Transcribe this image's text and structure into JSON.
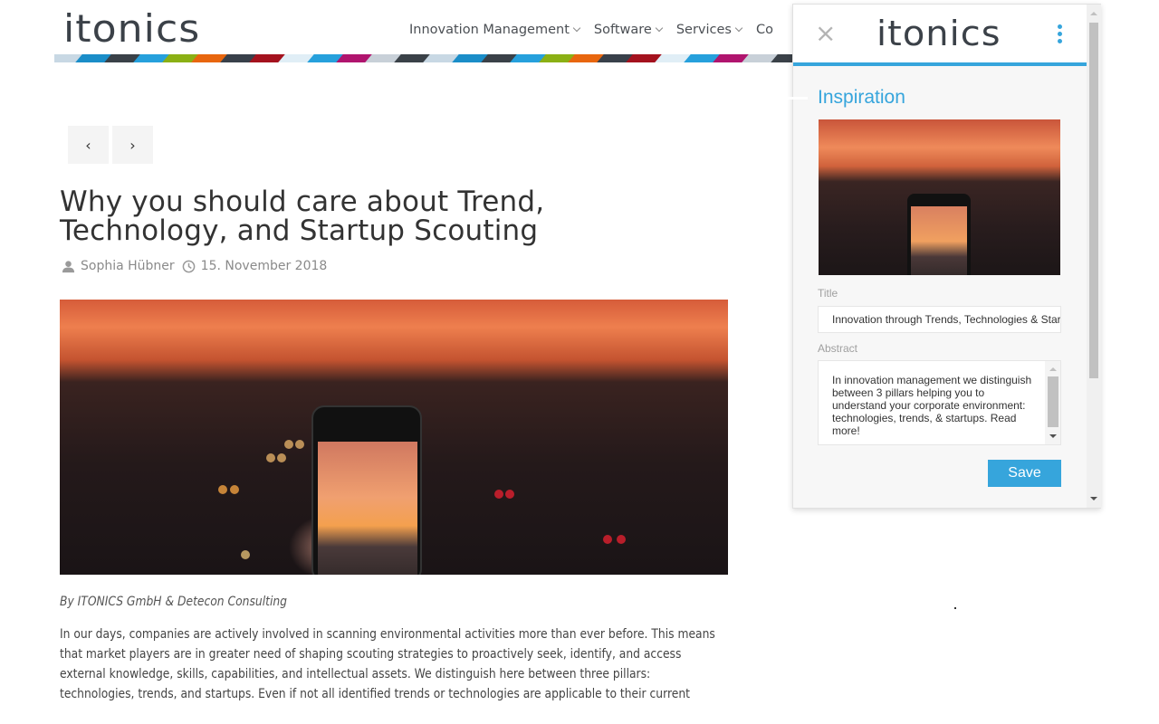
{
  "site": {
    "logo": "itonics",
    "nav": [
      {
        "label": "Innovation Management"
      },
      {
        "label": "Software"
      },
      {
        "label": "Services"
      },
      {
        "label": "Co"
      }
    ],
    "ribbon_colors": [
      "#c8d8e4",
      "#1a8dc8",
      "#3a4148",
      "#26a0dc",
      "#8bb014",
      "#e8660e",
      "#38404a",
      "#a4121e",
      "#e0eef6",
      "#26a0dc",
      "#b0146e",
      "#c8d0d8",
      "#3a4148",
      "#c8d8e4",
      "#1a8dc8",
      "#3a4148",
      "#26a0dc",
      "#8bb014",
      "#e8660e",
      "#38404a",
      "#a4121e",
      "#e0eef6",
      "#26a0dc",
      "#b0146e",
      "#c8d0d8",
      "#3a4148"
    ]
  },
  "article": {
    "pager": {
      "prev": "‹",
      "next": "›"
    },
    "title": "Why you should care about Trend, Technology, and Startup Scouting",
    "author": "Sophia Hübner",
    "date": "15. November 2018",
    "hero_alt": "Hand holding smartphone photographing city sunset over highway",
    "byline": "By ITONICS GmbH & Detecon Consulting",
    "body": "In our days, companies are actively involved in scanning environmental activities more than ever before. This means that market players are in greater need of shaping scouting strategies to proactively seek, identify, and access external knowledge, skills, capabilities, and intellectual assets. We distinguish here between three pillars: technologies, trends, and startups. Even if not all identified trends or technologies are applicable to their current"
  },
  "panel": {
    "logo": "itonics",
    "close": "×",
    "heading": "Inspiration",
    "title_label": "Title",
    "title_value": "Innovation through Trends, Technologies & Startups",
    "abstract_label": "Abstract",
    "abstract_value": "In innovation management we distinguish between 3 pillars helping you to understand your corporate environment: technologies, trends, & startups. Read more!",
    "save_label": "Save",
    "accent": "#36a5dc"
  }
}
